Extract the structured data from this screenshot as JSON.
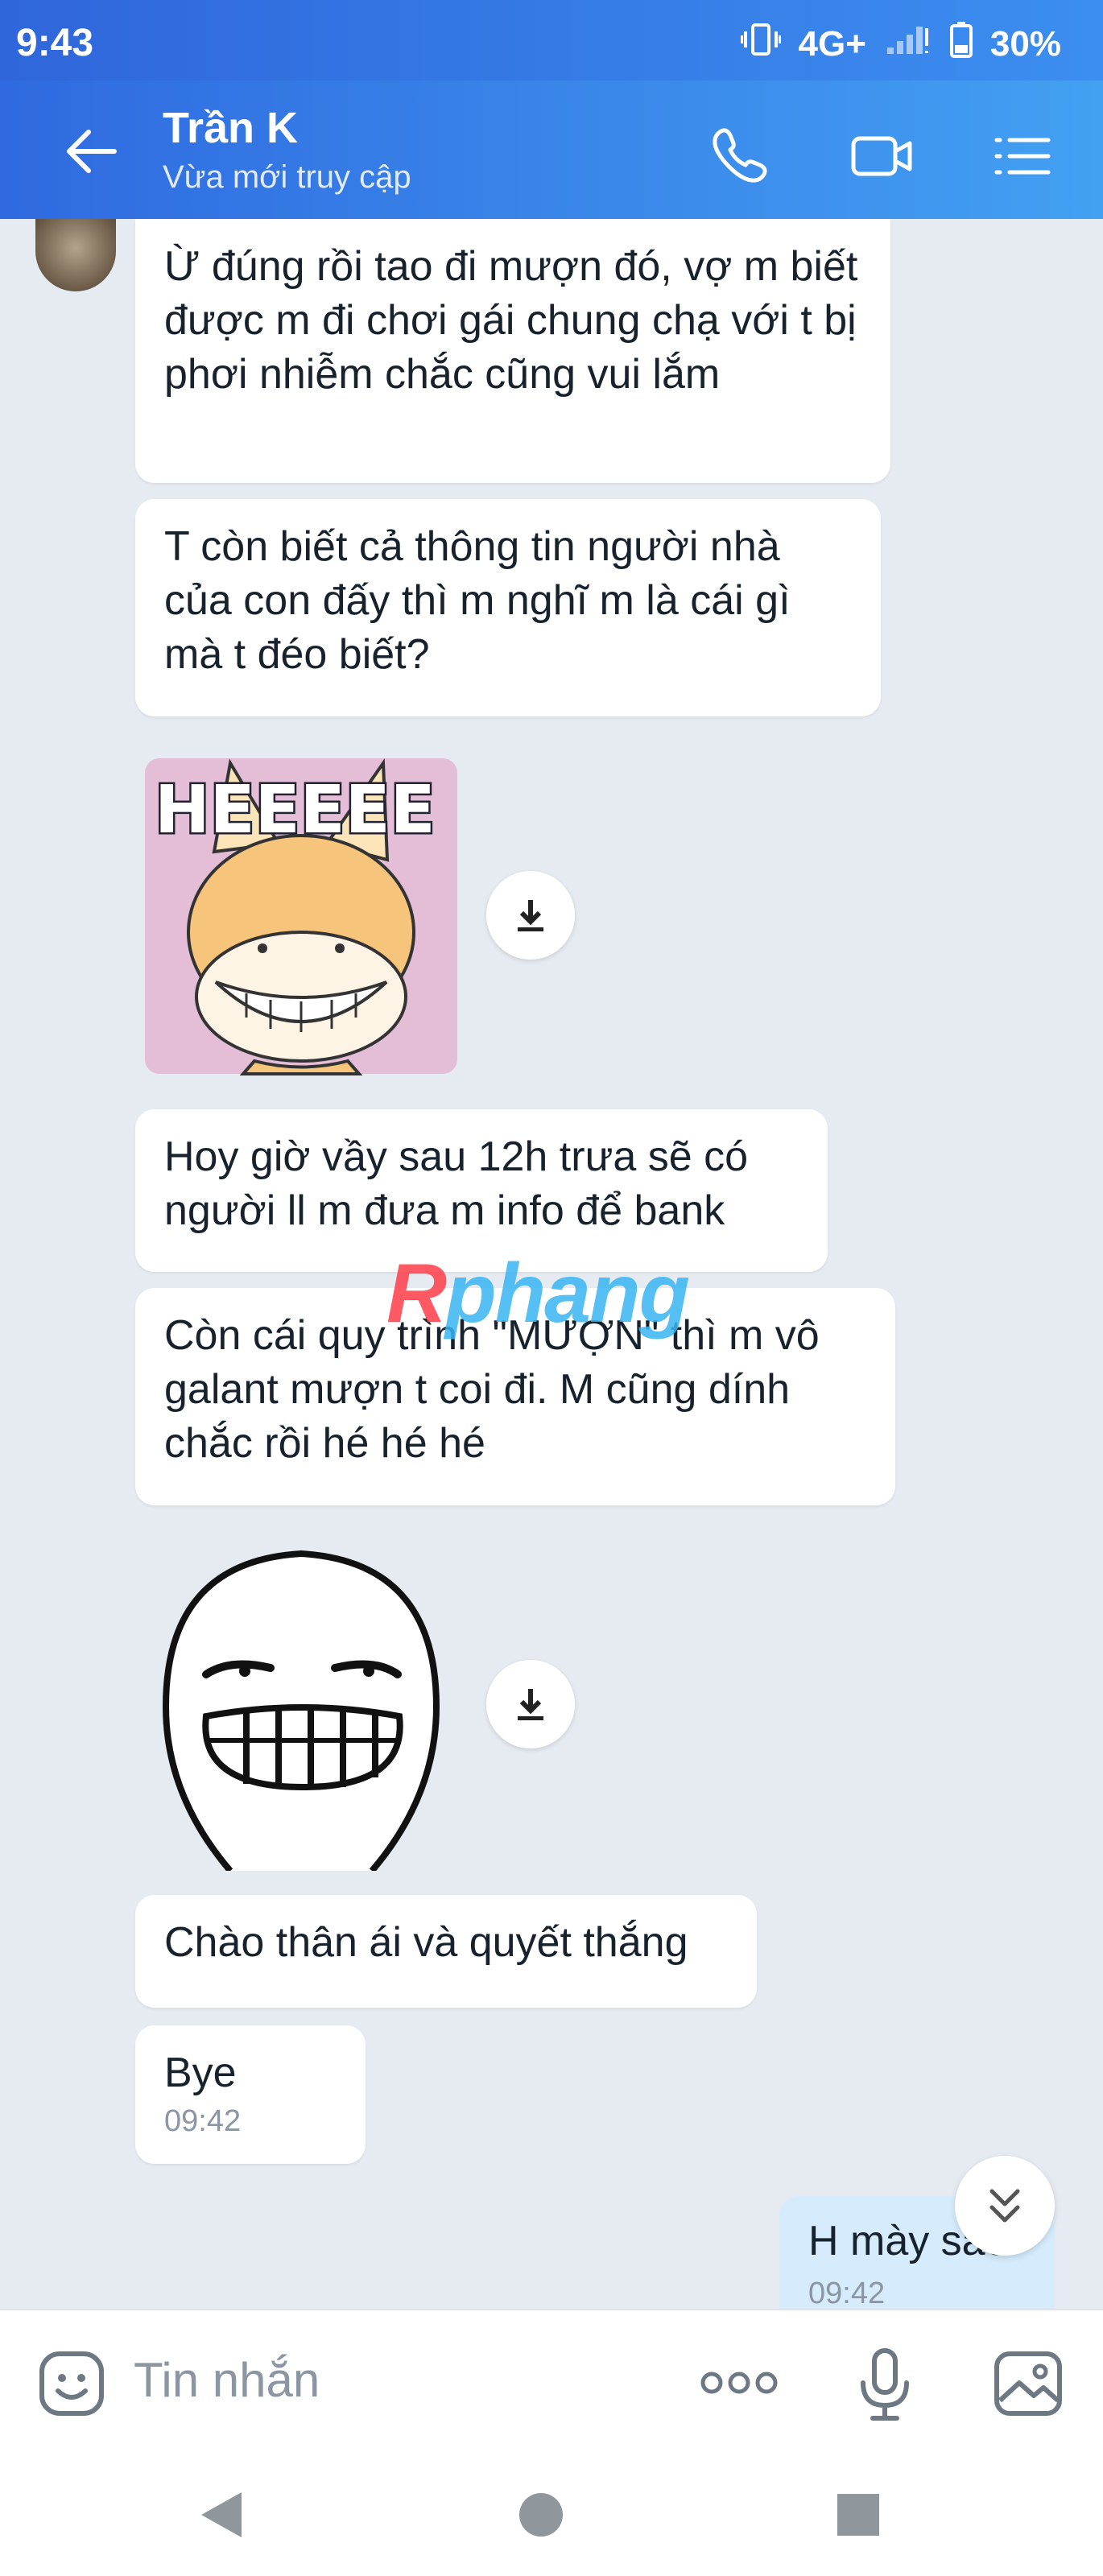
{
  "status_bar": {
    "time": "9:43",
    "network": "4G+",
    "battery": "30%"
  },
  "header": {
    "contact_name": "Trần K",
    "contact_status": "Vừa mới truy cập",
    "icons": [
      "back-arrow-icon",
      "phone-icon",
      "video-call-icon",
      "menu-list-icon"
    ]
  },
  "messages": [
    {
      "type": "text",
      "from": "contact",
      "text": "Ừ đúng rồi tao đi mượn đó, vợ m biết được m đi chơi gái chung chạ với t bị phơi nhiễm chắc cũng vui lắm"
    },
    {
      "type": "text",
      "from": "contact",
      "text": "T còn biết cả thông tin người nhà của con đấy thì m nghĩ m là cái gì mà t đéo biết?"
    },
    {
      "type": "sticker",
      "from": "contact",
      "sticker_text": "HEEEEE",
      "icon": "fox-grin-sticker"
    },
    {
      "type": "text",
      "from": "contact",
      "text": "Hoy giờ vầy sau 12h trưa sẽ có người ll m đưa m info để bank"
    },
    {
      "type": "text",
      "from": "contact",
      "text": "Còn cái quy trình \"MƯỢN\" thì m vô galant mượn t coi đi. M cũng dính chắc rồi hé hé hé"
    },
    {
      "type": "sticker",
      "from": "contact",
      "icon": "smug-grin-sticker"
    },
    {
      "type": "text",
      "from": "contact",
      "text": "Chào thân ái và quyết thắng"
    },
    {
      "type": "text",
      "from": "contact",
      "text": "Bye",
      "time": "09:42"
    },
    {
      "type": "text",
      "from": "me",
      "text": "H mày sao",
      "time": "09:42"
    }
  ],
  "watermark": {
    "part1": "R",
    "part2": "phang"
  },
  "input_bar": {
    "placeholder": "Tin nhắn",
    "icons": [
      "emoji-icon",
      "more-dots-icon",
      "microphone-icon",
      "image-icon"
    ]
  },
  "colors": {
    "header_start": "#2f6ae0",
    "header_end": "#43a0f2",
    "chat_bg": "#e6ebf1",
    "bubble_contact": "#ffffff",
    "bubble_me": "#d6ecfd"
  }
}
